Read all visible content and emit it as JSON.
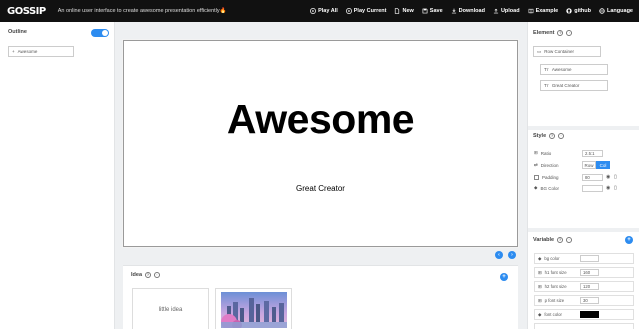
{
  "app": {
    "logo": "GOSSIP",
    "tagline": "An online user interface to create awesome presentation efficiently🔥"
  },
  "toolbar": [
    {
      "label": "Play All",
      "icon": "play-icon"
    },
    {
      "label": "Play Current",
      "icon": "play-icon"
    },
    {
      "label": "New",
      "icon": "file-icon"
    },
    {
      "label": "Save",
      "icon": "save-icon"
    },
    {
      "label": "Download",
      "icon": "download-icon"
    },
    {
      "label": "Upload",
      "icon": "upload-icon"
    },
    {
      "label": "Example",
      "icon": "book-icon"
    },
    {
      "label": "github",
      "icon": "github-icon"
    },
    {
      "label": "Language",
      "icon": "globe-icon"
    }
  ],
  "outline": {
    "title": "Outline",
    "toggle_on": true,
    "items": [
      {
        "label": "Awesome"
      }
    ]
  },
  "slide": {
    "heading": "Awesome",
    "paragraph": "Great Creator"
  },
  "nav": {
    "prev": "‹",
    "next": "›"
  },
  "idea": {
    "title": "Idea",
    "cards": [
      {
        "label": "little idea"
      },
      {
        "label": ""
      }
    ]
  },
  "element": {
    "title": "Element",
    "tree": [
      {
        "label": "Row Container"
      },
      {
        "label": "Awesome"
      },
      {
        "label": "Great Creator"
      }
    ]
  },
  "style": {
    "title": "Style",
    "ratio": {
      "label": "Ratio",
      "value": "2.5:1"
    },
    "direction": {
      "label": "Direction",
      "options": [
        "Row",
        "Col"
      ],
      "selected": "Col"
    },
    "padding": {
      "label": "Padding",
      "value": "80"
    },
    "bg_color": {
      "label": "BG Color",
      "value": ""
    }
  },
  "variable": {
    "title": "Variable",
    "items": [
      {
        "name": "bg color",
        "value": ""
      },
      {
        "name": "h1 font size",
        "value": "160"
      },
      {
        "name": "h2 font size",
        "value": "120"
      },
      {
        "name": "p font size",
        "value": "30"
      },
      {
        "name": "font color",
        "value": "",
        "swatch": "#000000"
      }
    ]
  },
  "colors": {
    "accent": "#2d8cf0",
    "topbar": "#111111"
  }
}
